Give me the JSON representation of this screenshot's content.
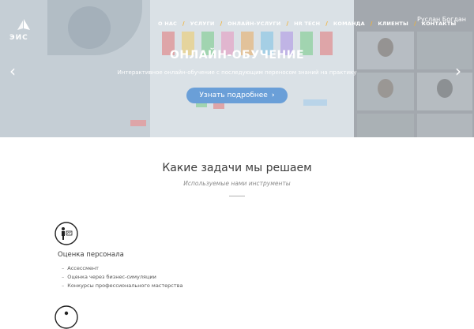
{
  "logo": {
    "text": "ЭИС"
  },
  "nav": {
    "items": [
      {
        "label": "О нас"
      },
      {
        "label": "Услуги"
      },
      {
        "label": "Онлайн-услуги"
      },
      {
        "label": "HR Tech"
      },
      {
        "label": "Команда"
      },
      {
        "label": "Клиенты"
      },
      {
        "label": "Контакты"
      }
    ]
  },
  "hero": {
    "user_name": "Руслан Богдан",
    "title": "ОНЛАЙН-ОБУЧЕНИЕ",
    "subtitle": "Интерактивное онлайн-обучение с последующим переносом знаний на практику",
    "button_label": "Узнать подробнее",
    "button_chevron": "›",
    "prev_arrow": "‹",
    "next_arrow": "›"
  },
  "section": {
    "title": "Какие задачи мы решаем",
    "subtitle": "Используемые нами инструменты"
  },
  "service": {
    "title": "Оценка персонала",
    "items": [
      {
        "label": "Ассессмент"
      },
      {
        "label": "Оценка через бизнес-симуляции"
      },
      {
        "label": "Конкурсы профессионального мастерства"
      }
    ]
  },
  "colors": {
    "accent_button": "#6a9fd8",
    "nav_separator": "#f2b233"
  }
}
